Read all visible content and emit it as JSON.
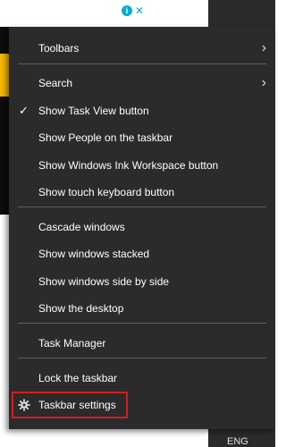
{
  "menu": {
    "items": [
      {
        "label": "Toolbars",
        "has_submenu": true,
        "checked": false
      },
      {
        "label": "Search",
        "has_submenu": true,
        "checked": false
      },
      {
        "label": "Show Task View button",
        "has_submenu": false,
        "checked": true
      },
      {
        "label": "Show People on the taskbar",
        "has_submenu": false,
        "checked": false
      },
      {
        "label": "Show Windows Ink Workspace button",
        "has_submenu": false,
        "checked": false
      },
      {
        "label": "Show touch keyboard button",
        "has_submenu": false,
        "checked": false
      },
      {
        "label": "Cascade windows",
        "has_submenu": false,
        "checked": false
      },
      {
        "label": "Show windows stacked",
        "has_submenu": false,
        "checked": false
      },
      {
        "label": "Show windows side by side",
        "has_submenu": false,
        "checked": false
      },
      {
        "label": "Show the desktop",
        "has_submenu": false,
        "checked": false
      },
      {
        "label": "Task Manager",
        "has_submenu": false,
        "checked": false
      },
      {
        "label": "Lock the taskbar",
        "has_submenu": false,
        "checked": false
      },
      {
        "label": "Taskbar settings",
        "has_submenu": false,
        "checked": false,
        "icon": "gear-icon",
        "highlighted": true
      }
    ]
  },
  "taskbar": {
    "language": "ENG"
  },
  "colors": {
    "menu_bg": "#2b2b2b",
    "separator": "#5e5e5e",
    "highlight_border": "#d31d24"
  }
}
